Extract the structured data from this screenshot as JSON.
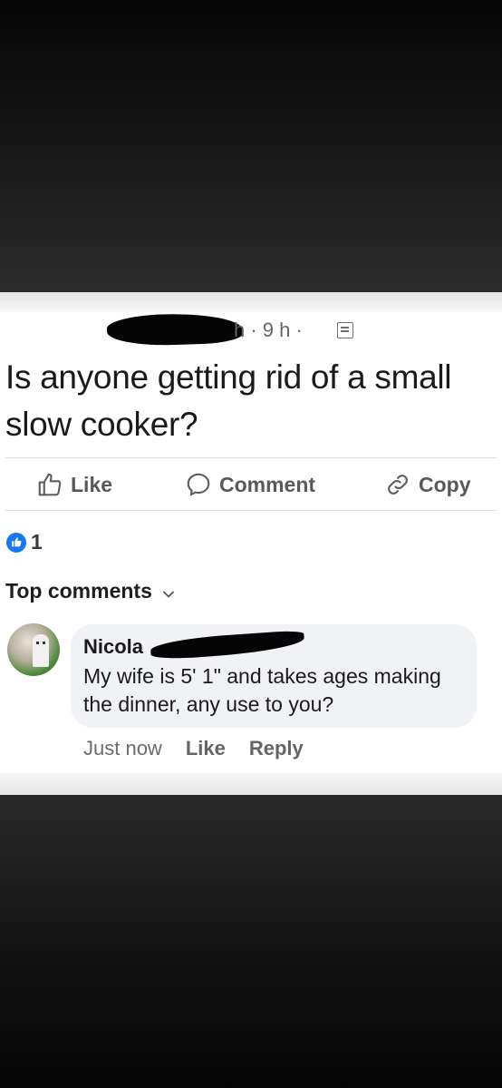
{
  "post": {
    "meta": "h · 9 h ·",
    "privacy_icon": "building-icon",
    "text": "Is anyone getting rid of a small slow cooker?"
  },
  "actions": {
    "like_label": "Like",
    "comment_label": "Comment",
    "copy_label": "Copy"
  },
  "reactions": {
    "count": "1",
    "icon": "thumbs-up-icon",
    "color": "#1877f2"
  },
  "comments_section": {
    "sort_label": "Top comments"
  },
  "comment": {
    "author": "Nicola",
    "text": "My wife  is 5' 1\" and takes ages making the dinner, any use to you?",
    "time": "Just now",
    "like_label": "Like",
    "reply_label": "Reply"
  }
}
